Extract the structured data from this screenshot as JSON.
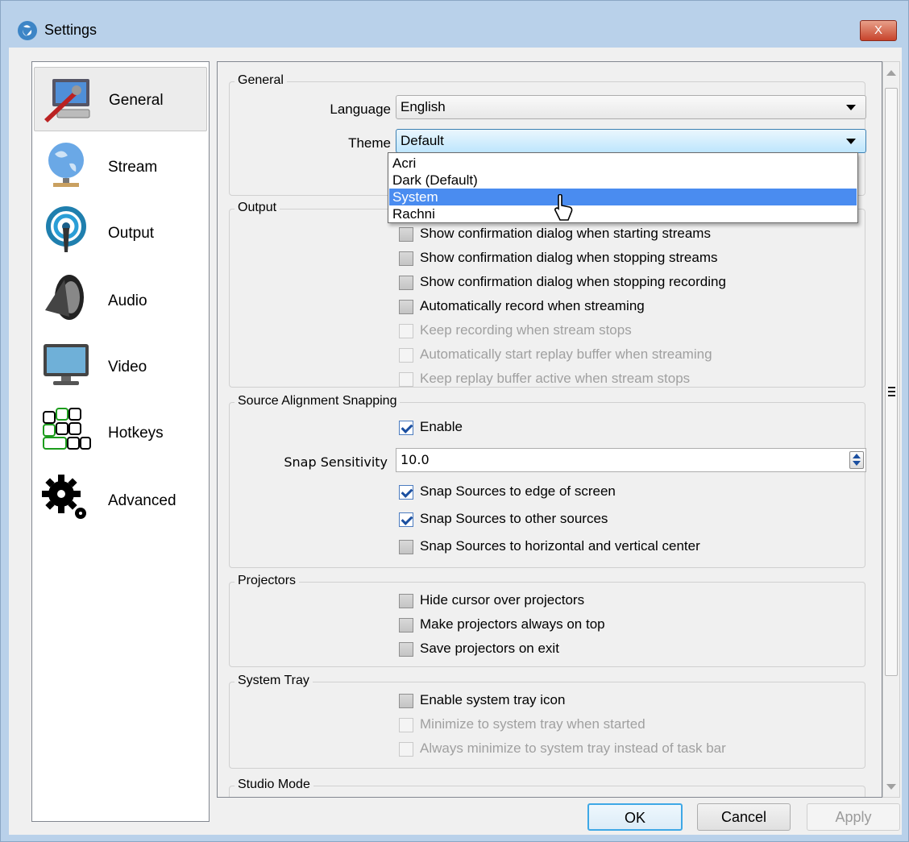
{
  "window": {
    "title": "Settings",
    "close_label": "X"
  },
  "sidebar": {
    "items": [
      {
        "label": "General",
        "icon": "computer-wrench-icon",
        "selected": true
      },
      {
        "label": "Stream",
        "icon": "globe-network-icon"
      },
      {
        "label": "Output",
        "icon": "broadcast-antenna-icon"
      },
      {
        "label": "Audio",
        "icon": "speaker-icon"
      },
      {
        "label": "Video",
        "icon": "monitor-icon"
      },
      {
        "label": "Hotkeys",
        "icon": "keyboard-keys-icon"
      },
      {
        "label": "Advanced",
        "icon": "gears-icon"
      }
    ]
  },
  "general": {
    "title": "General",
    "language_label": "Language",
    "language_value": "English",
    "theme_label": "Theme",
    "theme_value": "Default",
    "theme_options": [
      "Acri",
      "Dark (Default)",
      "System",
      "Rachni"
    ],
    "theme_highlighted": "System"
  },
  "output": {
    "title": "Output",
    "options": [
      {
        "label": "Show confirmation dialog when starting streams",
        "checked": false,
        "disabled": false
      },
      {
        "label": "Show confirmation dialog when stopping streams",
        "checked": false,
        "disabled": false
      },
      {
        "label": "Show confirmation dialog when stopping recording",
        "checked": false,
        "disabled": false
      },
      {
        "label": "Automatically record when streaming",
        "checked": false,
        "disabled": false
      },
      {
        "label": "Keep recording when stream stops",
        "checked": false,
        "disabled": true
      },
      {
        "label": "Automatically start replay buffer when streaming",
        "checked": false,
        "disabled": true
      },
      {
        "label": "Keep replay buffer active when stream stops",
        "checked": false,
        "disabled": true
      }
    ]
  },
  "snapping": {
    "title": "Source Alignment Snapping",
    "enable_label": "Enable",
    "sensitivity_label": "Snap Sensitivity",
    "sensitivity_value": "10.0",
    "options": [
      {
        "label": "Snap Sources to edge of screen",
        "checked": true
      },
      {
        "label": "Snap Sources to other sources",
        "checked": true
      },
      {
        "label": "Snap Sources to horizontal and vertical center",
        "checked": false
      }
    ]
  },
  "projectors": {
    "title": "Projectors",
    "options": [
      {
        "label": "Hide cursor over projectors"
      },
      {
        "label": "Make projectors always on top"
      },
      {
        "label": "Save projectors on exit"
      }
    ]
  },
  "tray": {
    "title": "System Tray",
    "options": [
      {
        "label": "Enable system tray icon",
        "disabled": false
      },
      {
        "label": "Minimize to system tray when started",
        "disabled": true
      },
      {
        "label": "Always minimize to system tray instead of task bar",
        "disabled": true
      }
    ]
  },
  "studio": {
    "title": "Studio Mode"
  },
  "buttons": {
    "ok": "OK",
    "cancel": "Cancel",
    "apply": "Apply"
  },
  "colors": {
    "accent": "#4a8cf0",
    "titlebar": "#b9d1ea",
    "close": "#c7432b"
  }
}
